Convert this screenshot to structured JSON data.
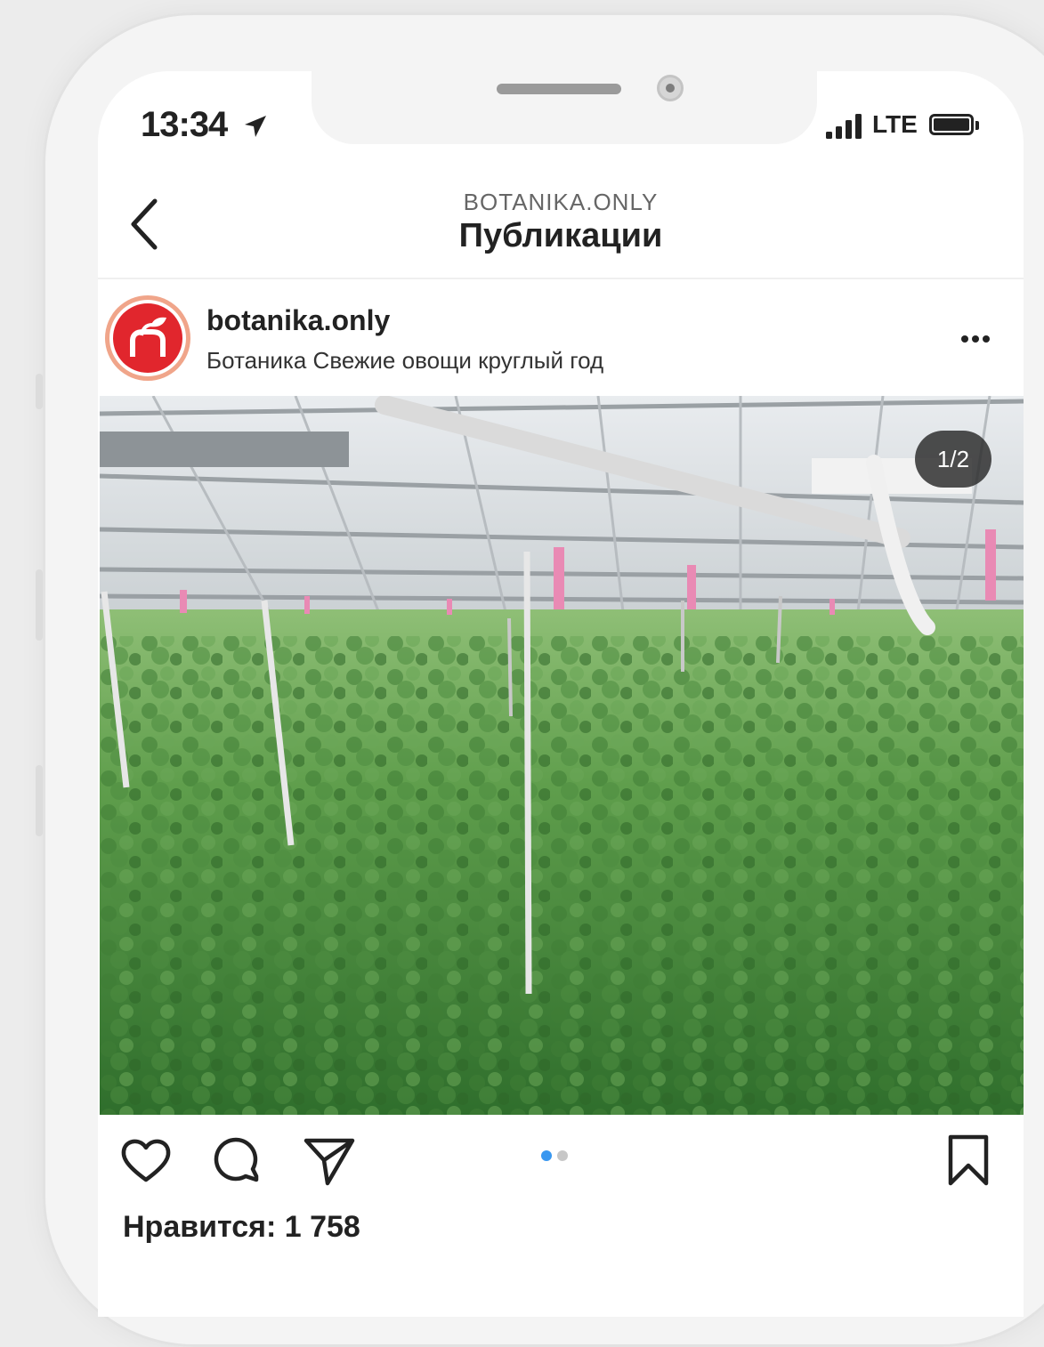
{
  "status_bar": {
    "time": "13:34",
    "network": "LTE",
    "battery_level": 1.0
  },
  "header": {
    "account": "BOTANIKA.ONLY",
    "title": "Публикации"
  },
  "post": {
    "username": "botanika.only",
    "subtitle": "Ботаника Свежие овощи круглый год",
    "image_counter": "1/2",
    "carousel_current": 1,
    "carousel_total": 2,
    "likes_label": "Нравится: 1 758"
  },
  "icons": {
    "back": "chevron-left-icon",
    "more": "more-icon",
    "like": "heart-icon",
    "comment": "comment-icon",
    "share": "send-icon",
    "save": "bookmark-icon"
  },
  "colors": {
    "brand_red": "#e1262d",
    "carousel_active": "#3897f0",
    "carousel_inactive": "#c7c7c7"
  }
}
